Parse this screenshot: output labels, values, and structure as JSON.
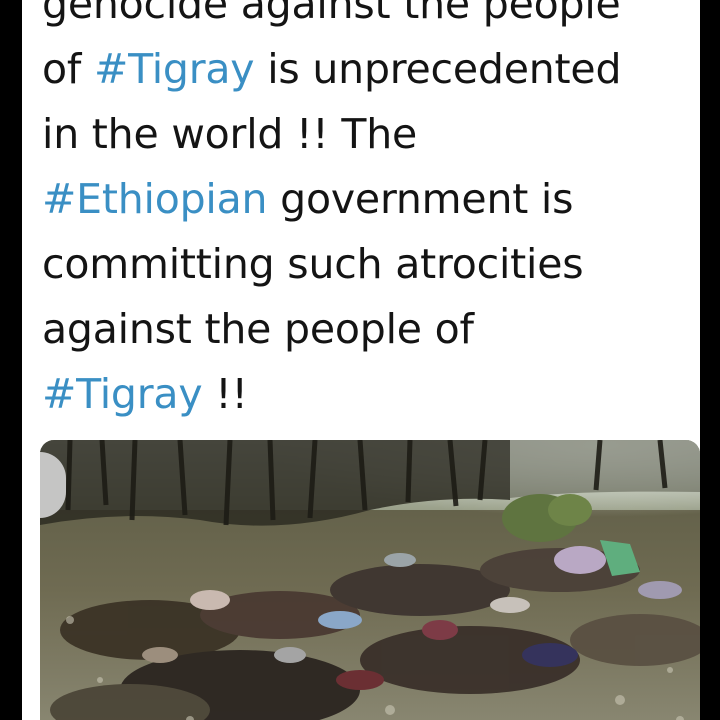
{
  "tweet": {
    "lines": [
      [
        {
          "text": "genocide against the people",
          "tag": false
        }
      ],
      [
        {
          "text": "of ",
          "tag": false
        },
        {
          "text": "#Tigray",
          "tag": true
        },
        {
          "text": " is unprecedented",
          "tag": false
        }
      ],
      [
        {
          "text": "in the world !! The",
          "tag": false
        }
      ],
      [
        {
          "text": "#Ethiopian",
          "tag": true
        },
        {
          "text": " government is",
          "tag": false
        }
      ],
      [
        {
          "text": "committing such atrocities",
          "tag": false
        }
      ],
      [
        {
          "text": "against the people of",
          "tag": false
        }
      ],
      [
        {
          "text": "#Tigray",
          "tag": true
        },
        {
          "text": " !!",
          "tag": false
        }
      ]
    ]
  },
  "colors": {
    "hashtag": "#3a8fc4",
    "text": "#141414",
    "card": "#ffffff",
    "backdrop": "#000000"
  },
  "media": {
    "icon": "photo-attachment"
  }
}
